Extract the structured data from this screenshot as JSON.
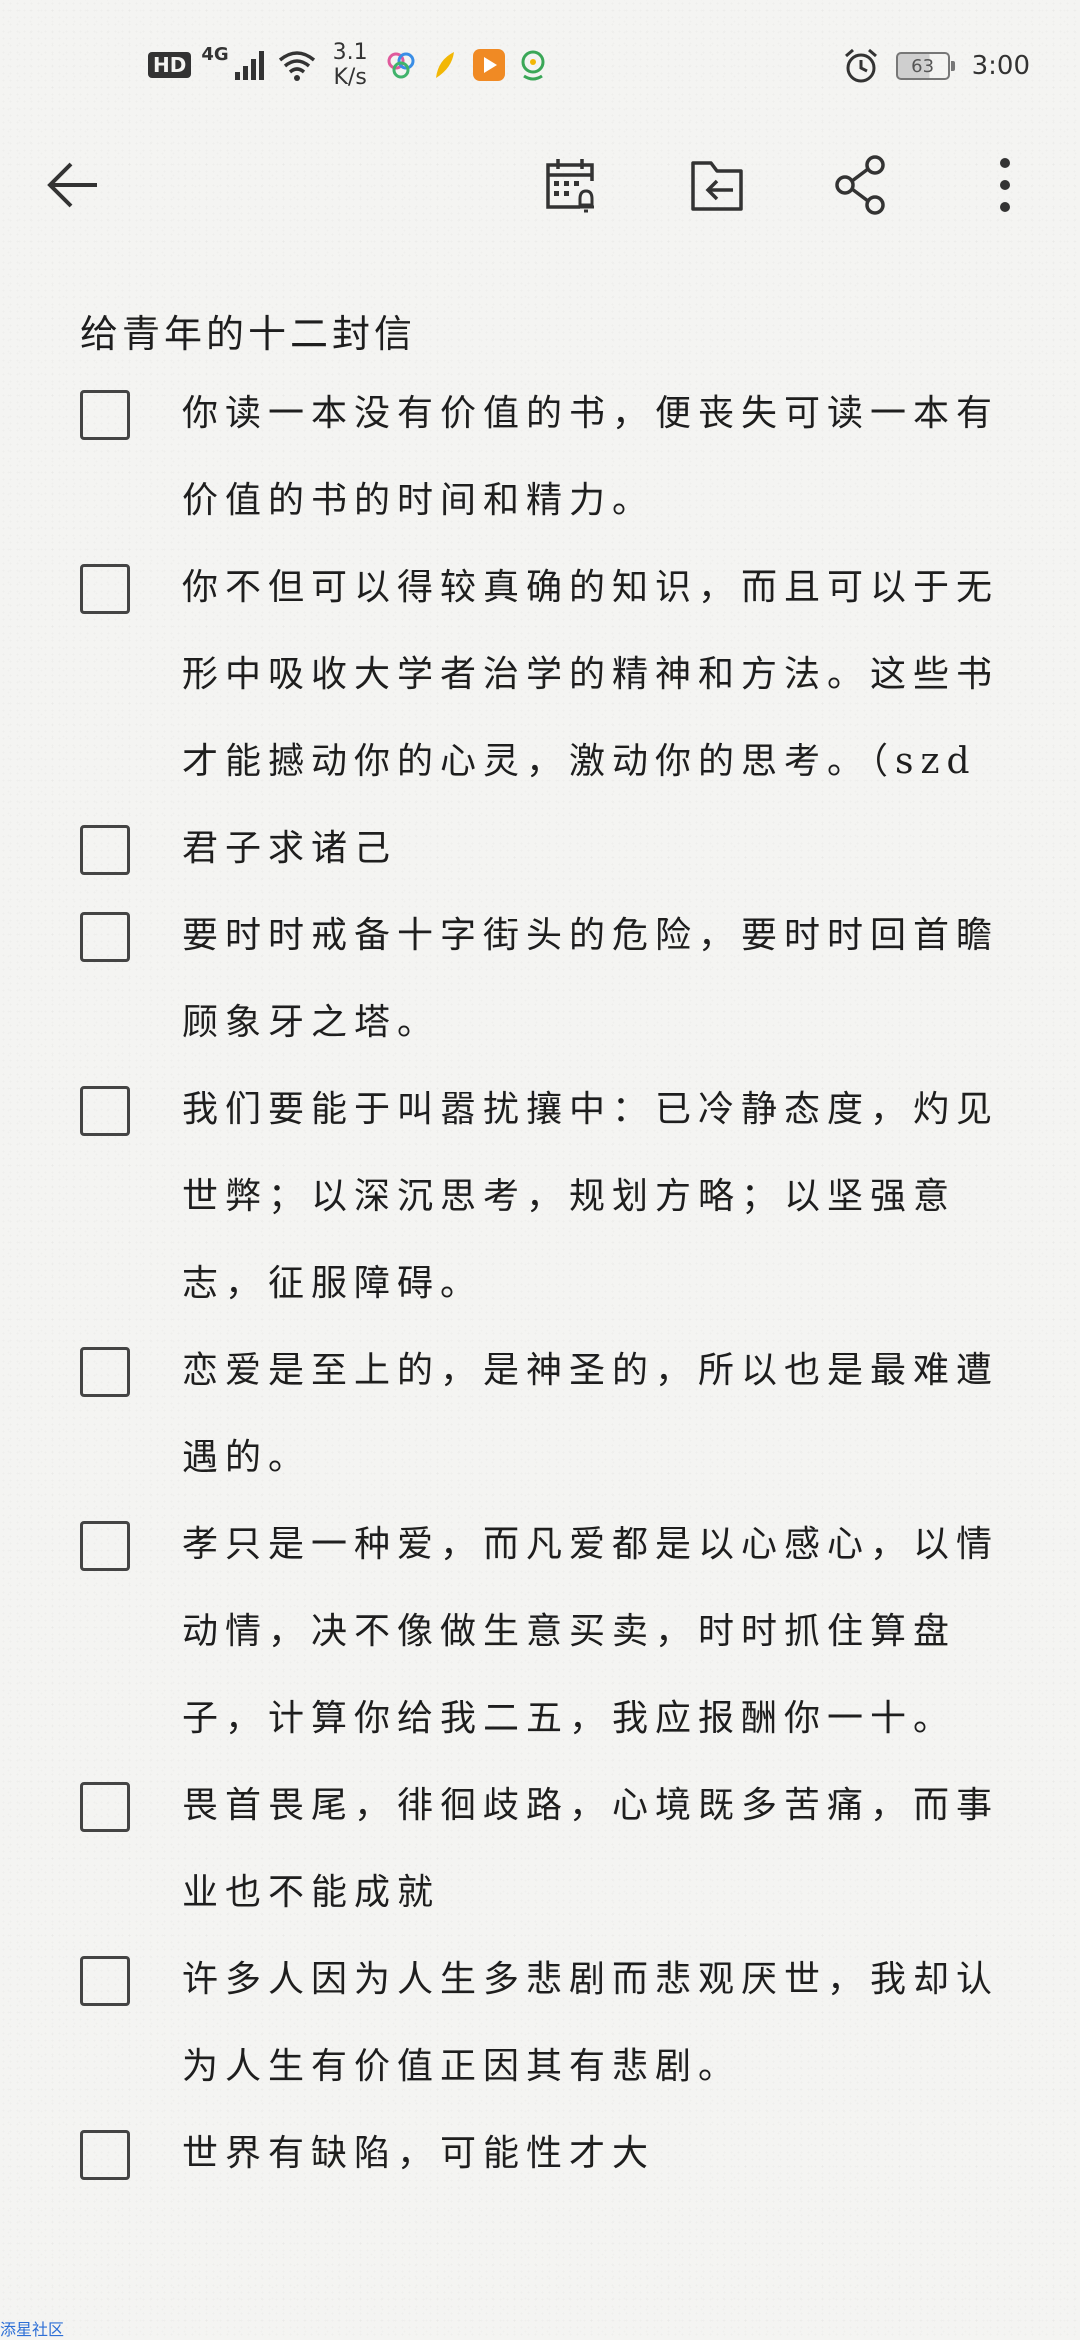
{
  "status_bar": {
    "hd": "HD",
    "network": "4G",
    "speed_value": "3.1",
    "speed_unit": "K/s",
    "battery": "63",
    "time": "3:00",
    "icons": [
      "signal-icon",
      "wifi-icon",
      "flower-app-icon",
      "feather-app-icon",
      "play-app-icon",
      "location-app-icon",
      "alarm-icon",
      "battery-icon"
    ],
    "colors": {
      "play_app": "#f08a24",
      "location_app": "#3aa757",
      "feather_app": "#f2b705"
    }
  },
  "toolbar": {
    "icons": [
      "back-arrow-icon",
      "calendar-reminder-icon",
      "move-to-folder-icon",
      "share-icon",
      "more-icon"
    ]
  },
  "note": {
    "title": "给青年的十二封信",
    "items": [
      {
        "text": "你读一本没有价值的书，便丧失可读一本有价值的书的时间和精力。",
        "checked": false
      },
      {
        "text": "你不但可以得较真确的知识，而且可以于无形中吸收大学者治学的精神和方法。这些书才能撼动你的心灵，激动你的思考。（szd",
        "checked": false
      },
      {
        "text": "君子求诸己",
        "checked": false
      },
      {
        "text": "要时时戒备十字街头的危险，要时时回首瞻顾象牙之塔。",
        "checked": false
      },
      {
        "text": "我们要能于叫嚣扰攘中：已冷静态度，灼见世弊；以深沉思考，规划方略；以坚强意志，征服障碍。",
        "checked": false
      },
      {
        "text": "恋爱是至上的，是神圣的，所以也是最难遭遇的。",
        "checked": false
      },
      {
        "text": "孝只是一种爱，而凡爱都是以心感心，以情动情，决不像做生意买卖，时时抓住算盘子，计算你给我二五，我应报酬你一十。",
        "checked": false
      },
      {
        "text": "畏首畏尾，徘徊歧路，心境既多苦痛，而事业也不能成就",
        "checked": false
      },
      {
        "text": "许多人因为人生多悲剧而悲观厌世，我却认为人生有价值正因其有悲剧。",
        "checked": false
      },
      {
        "text": "世界有缺陷，可能性才大",
        "checked": false
      }
    ]
  },
  "watermark": "添星社区"
}
